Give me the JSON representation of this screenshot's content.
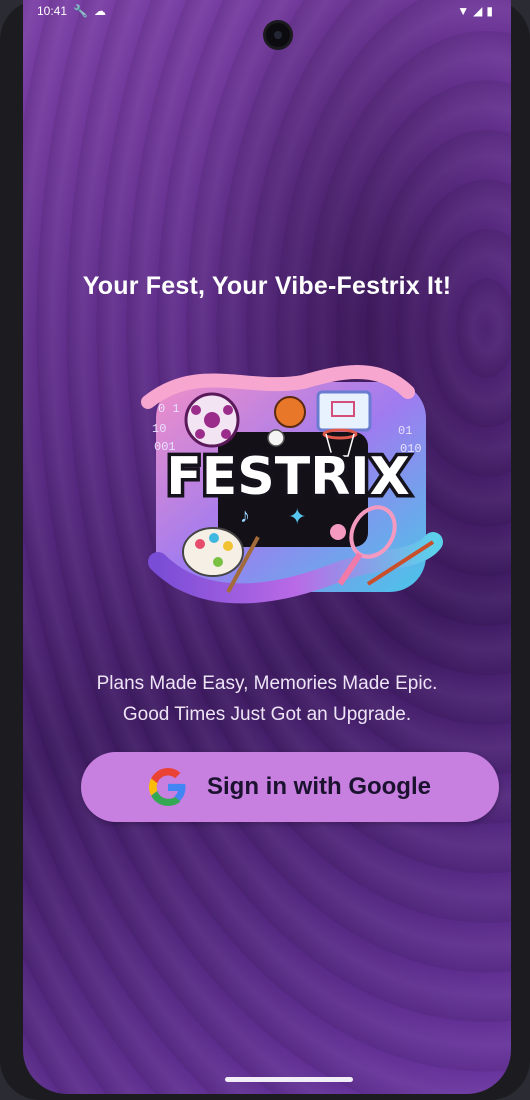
{
  "status_bar": {
    "time": "10:41"
  },
  "tagline": "Your Fest, Your Vibe-Festrix It!",
  "logo": {
    "wordmark": "FESTRIX"
  },
  "subtitle": {
    "line1": "Plans Made Easy, Memories Made Epic.",
    "line2": "Good Times Just Got an Upgrade."
  },
  "signin_button": {
    "label": "Sign in with Google",
    "icon": "google-icon"
  },
  "colors": {
    "button_bg": "#c77fe0",
    "background": "#5a2a85",
    "text": "#ffffff"
  }
}
